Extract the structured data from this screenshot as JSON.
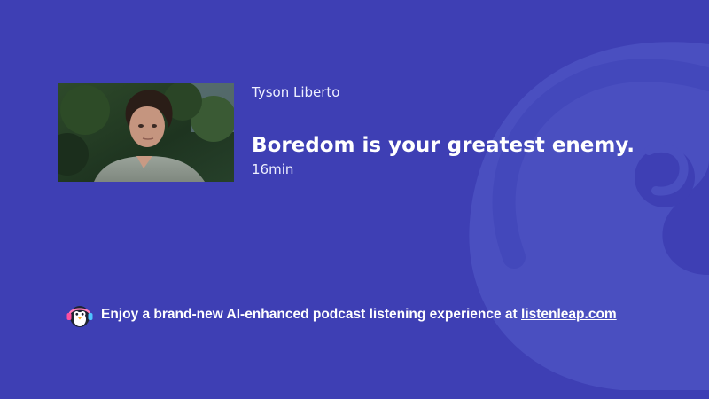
{
  "episode": {
    "author": "Tyson Liberto",
    "title": "Boredom is your greatest enemy.",
    "duration": "16min",
    "thumbnail_icon": "episode-thumbnail-photo"
  },
  "promo": {
    "text": "Enjoy a brand-new AI-enhanced podcast listening experience at ",
    "link_text": "listenleap.com",
    "logo_icon": "penguin-headphones-logo"
  },
  "colors": {
    "background": "#3e3fb4",
    "watermark": "#4a4fc0",
    "text": "#ffffff"
  }
}
